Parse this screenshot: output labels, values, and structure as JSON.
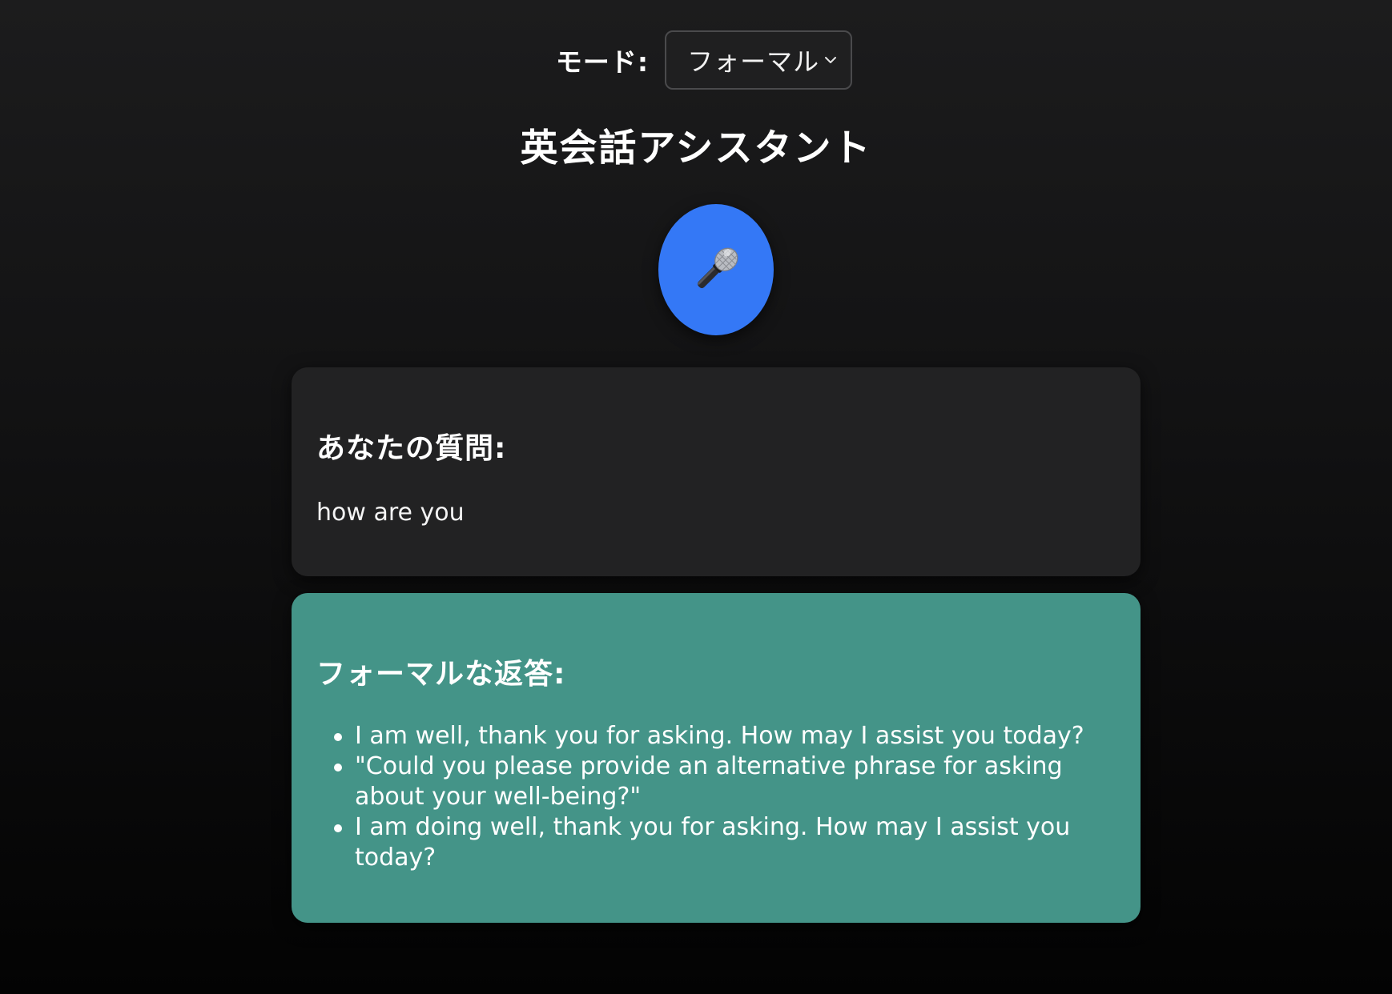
{
  "mode": {
    "label": "モード:",
    "selected": "フォーマル"
  },
  "title": "英会話アシスタント",
  "mic_button": {
    "icon": "microphone-icon",
    "color": "#3478f6"
  },
  "question": {
    "heading": "あなたの質問:",
    "text": "how are you"
  },
  "response": {
    "heading": "フォーマルな返答:",
    "color": "#449488",
    "items": [
      "I am well, thank you for asking. How may I assist you today?",
      "\"Could you please provide an alternative phrase for asking about your well-being?\"",
      "I am doing well, thank you for asking. How may I assist you today?"
    ]
  }
}
